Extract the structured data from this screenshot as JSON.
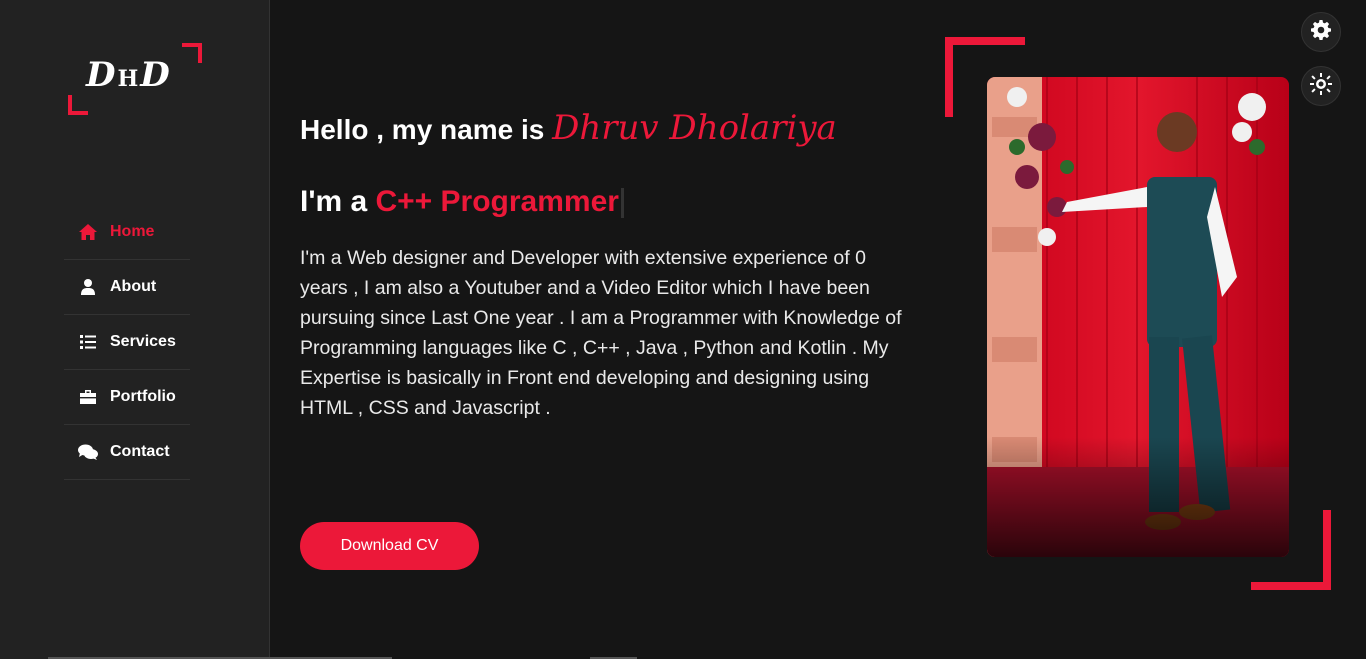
{
  "logo": {
    "text_d1": "D",
    "text_h": "H",
    "text_d2": "D"
  },
  "nav": {
    "items": [
      {
        "label": "Home",
        "icon": "home-icon",
        "active": true
      },
      {
        "label": "About",
        "icon": "user-icon",
        "active": false
      },
      {
        "label": "Services",
        "icon": "list-icon",
        "active": false
      },
      {
        "label": "Portfolio",
        "icon": "briefcase-icon",
        "active": false
      },
      {
        "label": "Contact",
        "icon": "comments-icon",
        "active": false
      }
    ]
  },
  "hero": {
    "greeting": "Hello , my name is ",
    "name": "Dhruv Dholariya",
    "role_prefix": "I'm a ",
    "role": "C++ Programmer",
    "about": "I'm a Web designer and Developer with extensive experience of 0 years , I am also a Youtuber and a Video Editor which I have been pursuing since Last One year . I am a Programmer with Knowledge of Programming languages like C , C++ , Java , Python and Kotlin . My Expertise is basically in Front end developing and designing using HTML , CSS and Javascript .",
    "cv_button": "Download CV"
  },
  "colors": {
    "accent": "#ec1839",
    "background": "#151515",
    "sidebar": "#222222"
  },
  "controls": {
    "settings_icon": "gear-icon",
    "theme_icon": "sun-icon"
  }
}
